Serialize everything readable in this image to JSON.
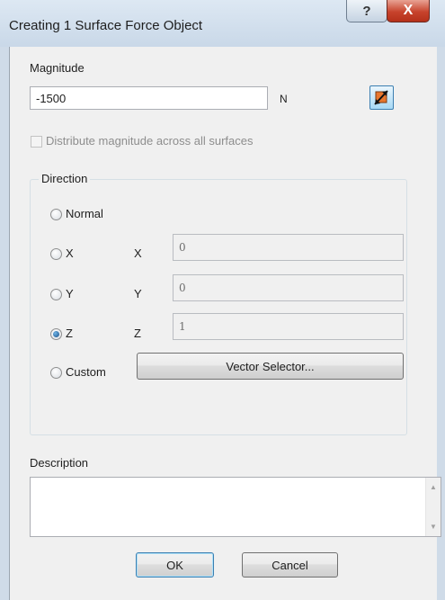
{
  "dialog": {
    "title": "Creating 1 Surface Force Object",
    "help_glyph": "?",
    "close_glyph": "X"
  },
  "magnitude": {
    "label": "Magnitude",
    "value": "-1500",
    "unit": "N",
    "distribute_label": "Distribute magnitude across all surfaces",
    "distribute_checked": false
  },
  "direction": {
    "group_label": "Direction",
    "normal_label": "Normal",
    "x_radio_label": "X",
    "y_radio_label": "Y",
    "z_radio_label": "Z",
    "custom_label": "Custom",
    "x_field_label": "X",
    "y_field_label": "Y",
    "z_field_label": "Z",
    "x_value": "0",
    "y_value": "0",
    "z_value": "1",
    "selected": "Z",
    "vector_selector_label": "Vector Selector..."
  },
  "description": {
    "label": "Description",
    "value": ""
  },
  "buttons": {
    "ok_label": "OK",
    "cancel_label": "Cancel"
  },
  "colors": {
    "accent_border": "#3c7fb1",
    "close_red": "#c7432c"
  },
  "icons": {
    "reverse_direction": "reverse-direction-arrow-icon"
  }
}
